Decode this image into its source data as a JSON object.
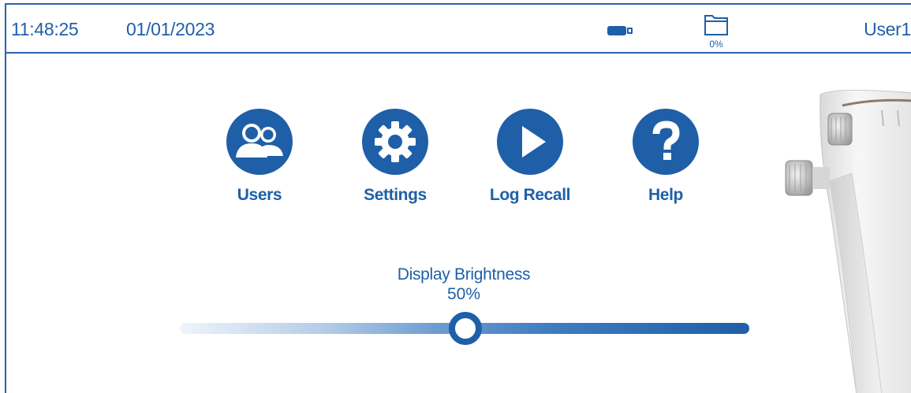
{
  "status_bar": {
    "time": "11:48:25",
    "date": "01/01/2023",
    "battery_icon": "battery-icon",
    "storage_icon": "folder-icon",
    "storage_percent": "0%",
    "user": "User1"
  },
  "menu": {
    "items": [
      {
        "label": "Users",
        "icon": "users-icon"
      },
      {
        "label": "Settings",
        "icon": "gear-icon"
      },
      {
        "label": "Log Recall",
        "icon": "play-icon"
      },
      {
        "label": "Help",
        "icon": "question-icon"
      }
    ]
  },
  "brightness": {
    "title": "Display Brightness",
    "value_label": "50%",
    "value": 50,
    "min": 0,
    "max": 100
  },
  "colors": {
    "accent": "#1f5fa8",
    "background": "#ffffff"
  }
}
